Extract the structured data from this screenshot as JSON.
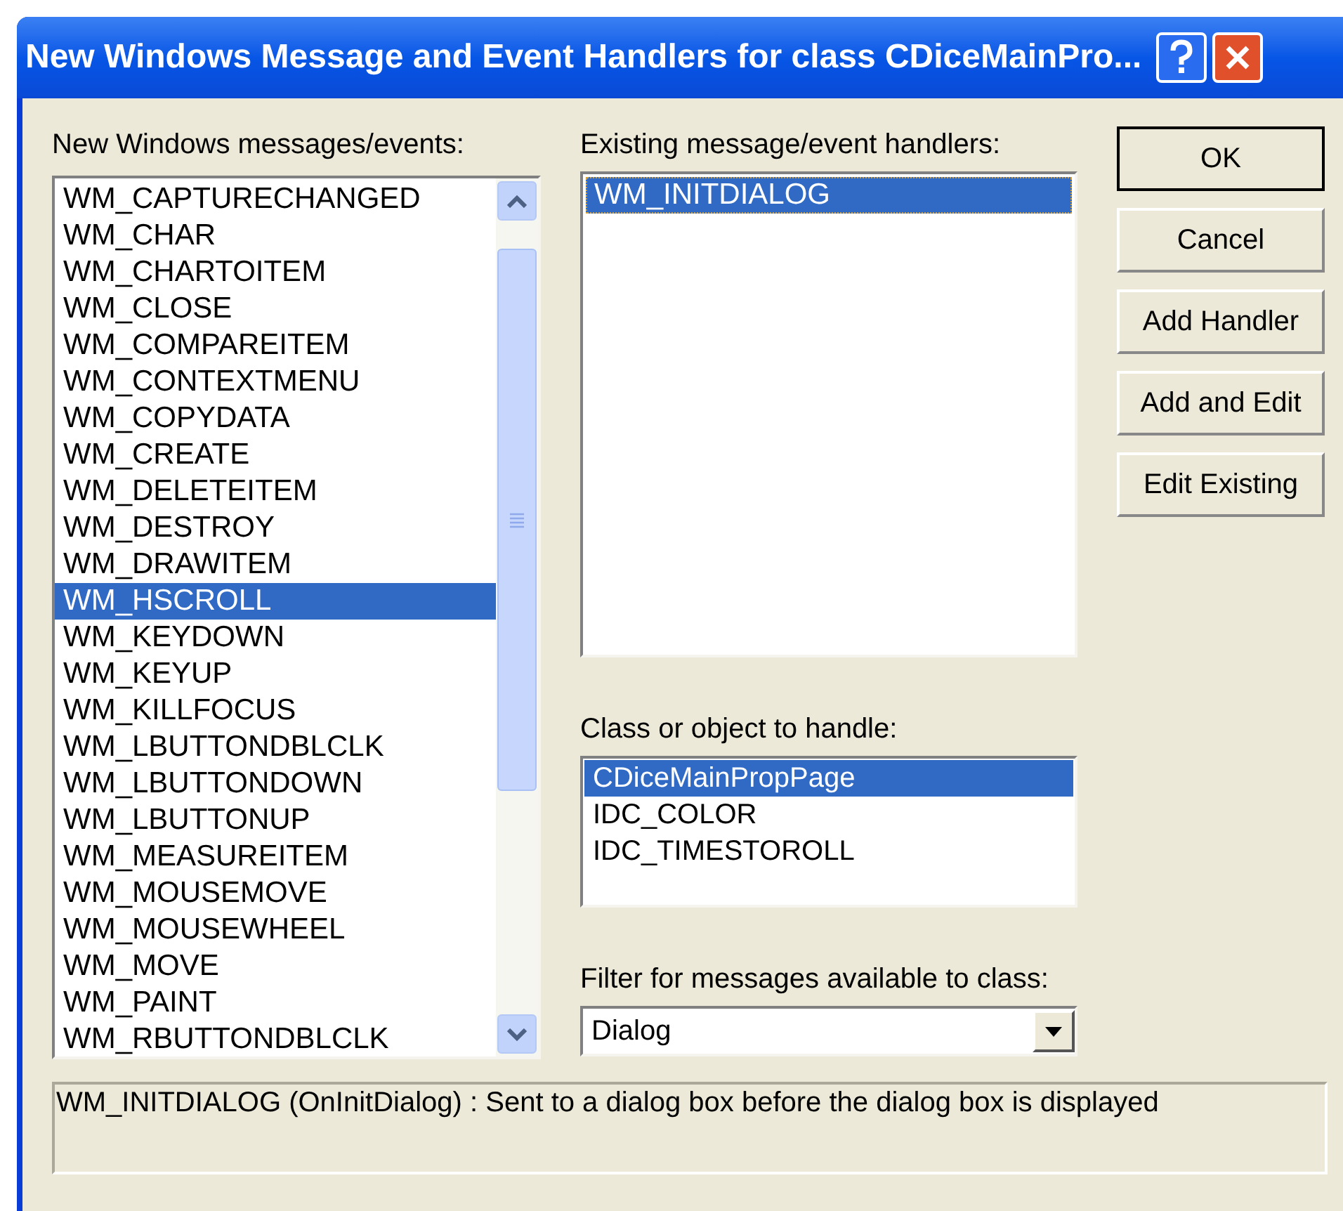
{
  "window": {
    "title": "New Windows Message and Event Handlers for class CDiceMainPro..."
  },
  "messages": {
    "label": "New Windows messages/events:",
    "items": [
      {
        "text": "WM_CAPTURECHANGED",
        "selected": false
      },
      {
        "text": "WM_CHAR",
        "selected": false
      },
      {
        "text": "WM_CHARTOITEM",
        "selected": false
      },
      {
        "text": "WM_CLOSE",
        "selected": false
      },
      {
        "text": "WM_COMPAREITEM",
        "selected": false
      },
      {
        "text": "WM_CONTEXTMENU",
        "selected": false
      },
      {
        "text": "WM_COPYDATA",
        "selected": false
      },
      {
        "text": "WM_CREATE",
        "selected": false
      },
      {
        "text": "WM_DELETEITEM",
        "selected": false
      },
      {
        "text": "WM_DESTROY",
        "selected": false
      },
      {
        "text": "WM_DRAWITEM",
        "selected": false
      },
      {
        "text": "WM_HSCROLL",
        "selected": true
      },
      {
        "text": "WM_KEYDOWN",
        "selected": false
      },
      {
        "text": "WM_KEYUP",
        "selected": false
      },
      {
        "text": "WM_KILLFOCUS",
        "selected": false
      },
      {
        "text": "WM_LBUTTONDBLCLK",
        "selected": false
      },
      {
        "text": "WM_LBUTTONDOWN",
        "selected": false
      },
      {
        "text": "WM_LBUTTONUP",
        "selected": false
      },
      {
        "text": "WM_MEASUREITEM",
        "selected": false
      },
      {
        "text": "WM_MOUSEMOVE",
        "selected": false
      },
      {
        "text": "WM_MOUSEWHEEL",
        "selected": false
      },
      {
        "text": "WM_MOVE",
        "selected": false
      },
      {
        "text": "WM_PAINT",
        "selected": false
      },
      {
        "text": "WM_RBUTTONDBLCLK",
        "selected": false
      }
    ]
  },
  "handlers": {
    "label": "Existing message/event handlers:",
    "items": [
      {
        "text": "WM_INITDIALOG",
        "selected": true
      }
    ]
  },
  "classes": {
    "label": "Class or object to handle:",
    "items": [
      {
        "text": "CDiceMainPropPage",
        "selected": true
      },
      {
        "text": "IDC_COLOR",
        "selected": false
      },
      {
        "text": "IDC_TIMESTOROLL",
        "selected": false
      }
    ]
  },
  "filter": {
    "label": "Filter for messages available to class:",
    "value": "Dialog"
  },
  "buttons": [
    {
      "label": "OK",
      "default": true
    },
    {
      "label": "Cancel",
      "default": false
    },
    {
      "label": "Add Handler",
      "default": false
    },
    {
      "label": "Add and Edit",
      "default": false
    },
    {
      "label": "Edit Existing",
      "default": false
    }
  ],
  "description": "WM_INITDIALOG (OnInitDialog) : Sent to a dialog box before the dialog box is displayed"
}
